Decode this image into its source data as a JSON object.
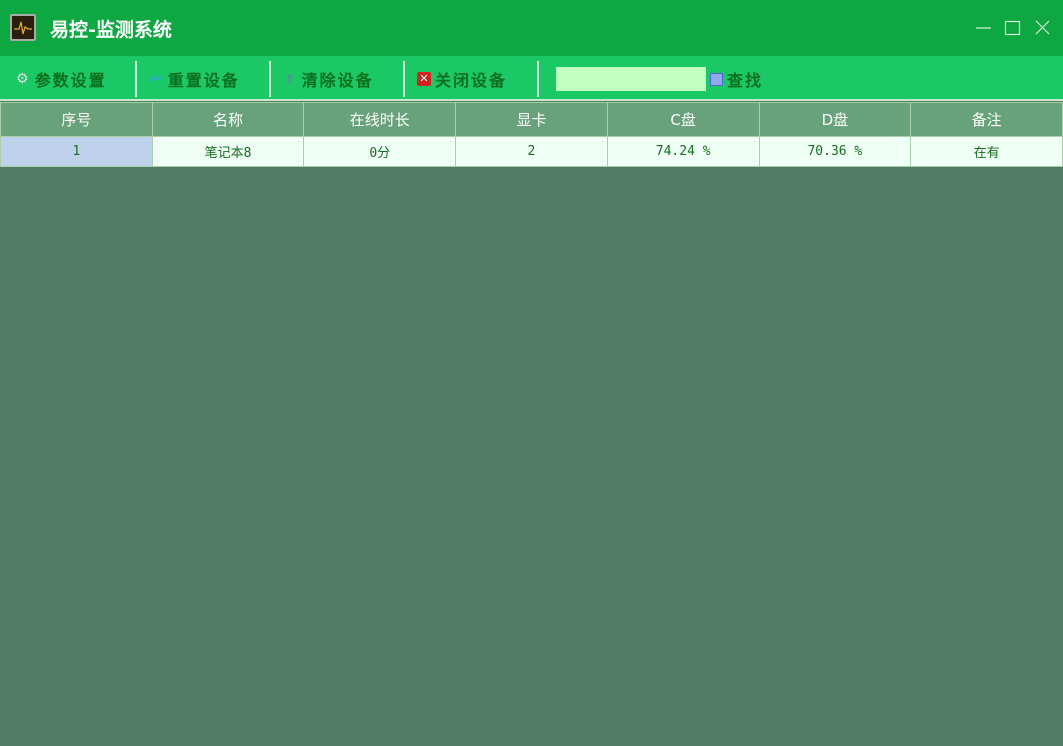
{
  "window": {
    "title": "易控-监测系统",
    "icon": "monitor-pulse-icon"
  },
  "toolbar": {
    "buttons": [
      {
        "label": "参数设置",
        "icon": "gear-icon"
      },
      {
        "label": "重置设备",
        "icon": "return-arrow-icon"
      },
      {
        "label": "清除设备",
        "icon": "broom-icon"
      },
      {
        "label": "关闭设备",
        "icon": "close-red-icon"
      }
    ],
    "search_value": "",
    "find_label": "查找"
  },
  "table": {
    "columns": [
      "序号",
      "名称",
      "在线时长",
      "显卡",
      "C盘",
      "D盘",
      "备注"
    ],
    "rows": [
      [
        "1",
        "笔记本8",
        "0分",
        "2",
        "74.24 %",
        "70.36 %",
        "在有"
      ]
    ]
  }
}
